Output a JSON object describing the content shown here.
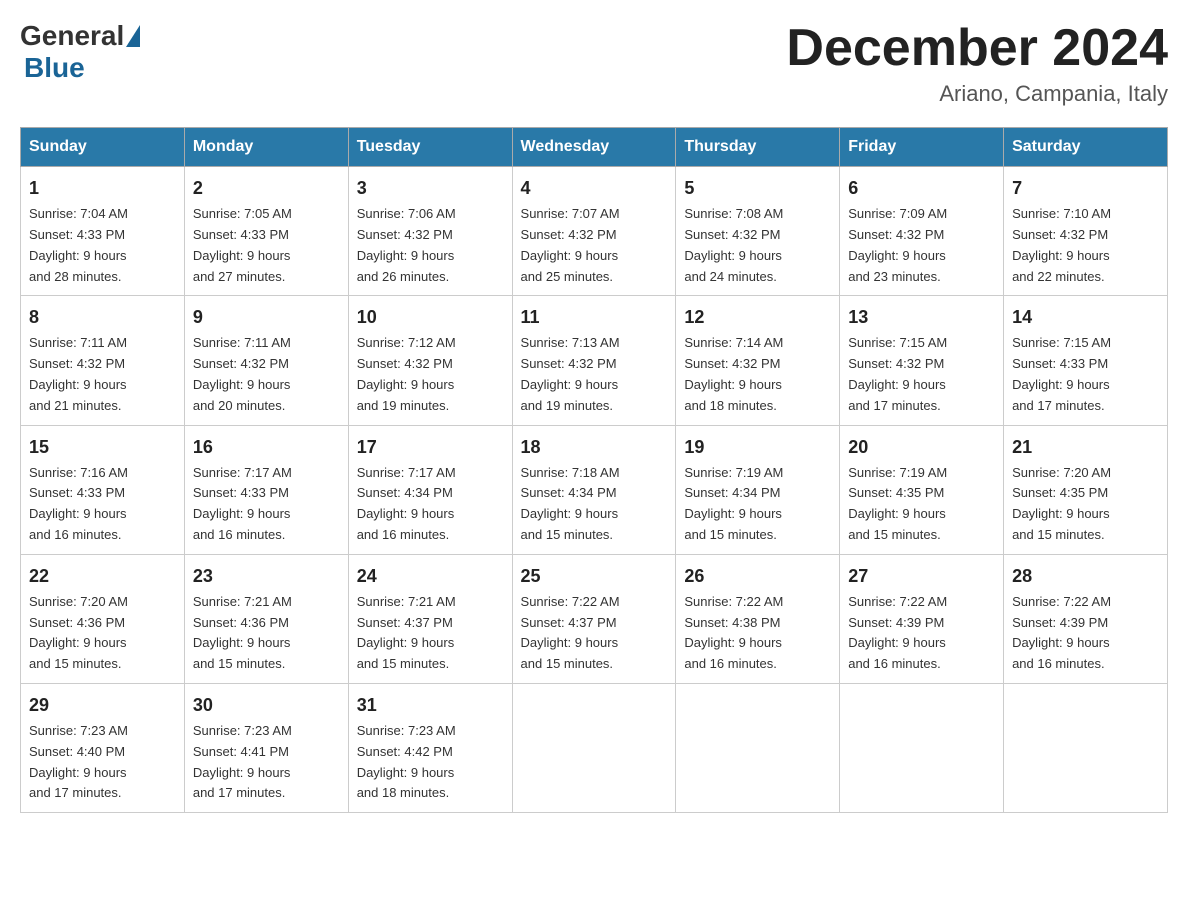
{
  "header": {
    "logo_general": "General",
    "logo_blue": "Blue",
    "month_title": "December 2024",
    "location": "Ariano, Campania, Italy"
  },
  "weekdays": [
    "Sunday",
    "Monday",
    "Tuesday",
    "Wednesday",
    "Thursday",
    "Friday",
    "Saturday"
  ],
  "weeks": [
    [
      {
        "day": "1",
        "sunrise": "7:04 AM",
        "sunset": "4:33 PM",
        "daylight": "9 hours and 28 minutes."
      },
      {
        "day": "2",
        "sunrise": "7:05 AM",
        "sunset": "4:33 PM",
        "daylight": "9 hours and 27 minutes."
      },
      {
        "day": "3",
        "sunrise": "7:06 AM",
        "sunset": "4:32 PM",
        "daylight": "9 hours and 26 minutes."
      },
      {
        "day": "4",
        "sunrise": "7:07 AM",
        "sunset": "4:32 PM",
        "daylight": "9 hours and 25 minutes."
      },
      {
        "day": "5",
        "sunrise": "7:08 AM",
        "sunset": "4:32 PM",
        "daylight": "9 hours and 24 minutes."
      },
      {
        "day": "6",
        "sunrise": "7:09 AM",
        "sunset": "4:32 PM",
        "daylight": "9 hours and 23 minutes."
      },
      {
        "day": "7",
        "sunrise": "7:10 AM",
        "sunset": "4:32 PM",
        "daylight": "9 hours and 22 minutes."
      }
    ],
    [
      {
        "day": "8",
        "sunrise": "7:11 AM",
        "sunset": "4:32 PM",
        "daylight": "9 hours and 21 minutes."
      },
      {
        "day": "9",
        "sunrise": "7:11 AM",
        "sunset": "4:32 PM",
        "daylight": "9 hours and 20 minutes."
      },
      {
        "day": "10",
        "sunrise": "7:12 AM",
        "sunset": "4:32 PM",
        "daylight": "9 hours and 19 minutes."
      },
      {
        "day": "11",
        "sunrise": "7:13 AM",
        "sunset": "4:32 PM",
        "daylight": "9 hours and 19 minutes."
      },
      {
        "day": "12",
        "sunrise": "7:14 AM",
        "sunset": "4:32 PM",
        "daylight": "9 hours and 18 minutes."
      },
      {
        "day": "13",
        "sunrise": "7:15 AM",
        "sunset": "4:32 PM",
        "daylight": "9 hours and 17 minutes."
      },
      {
        "day": "14",
        "sunrise": "7:15 AM",
        "sunset": "4:33 PM",
        "daylight": "9 hours and 17 minutes."
      }
    ],
    [
      {
        "day": "15",
        "sunrise": "7:16 AM",
        "sunset": "4:33 PM",
        "daylight": "9 hours and 16 minutes."
      },
      {
        "day": "16",
        "sunrise": "7:17 AM",
        "sunset": "4:33 PM",
        "daylight": "9 hours and 16 minutes."
      },
      {
        "day": "17",
        "sunrise": "7:17 AM",
        "sunset": "4:34 PM",
        "daylight": "9 hours and 16 minutes."
      },
      {
        "day": "18",
        "sunrise": "7:18 AM",
        "sunset": "4:34 PM",
        "daylight": "9 hours and 15 minutes."
      },
      {
        "day": "19",
        "sunrise": "7:19 AM",
        "sunset": "4:34 PM",
        "daylight": "9 hours and 15 minutes."
      },
      {
        "day": "20",
        "sunrise": "7:19 AM",
        "sunset": "4:35 PM",
        "daylight": "9 hours and 15 minutes."
      },
      {
        "day": "21",
        "sunrise": "7:20 AM",
        "sunset": "4:35 PM",
        "daylight": "9 hours and 15 minutes."
      }
    ],
    [
      {
        "day": "22",
        "sunrise": "7:20 AM",
        "sunset": "4:36 PM",
        "daylight": "9 hours and 15 minutes."
      },
      {
        "day": "23",
        "sunrise": "7:21 AM",
        "sunset": "4:36 PM",
        "daylight": "9 hours and 15 minutes."
      },
      {
        "day": "24",
        "sunrise": "7:21 AM",
        "sunset": "4:37 PM",
        "daylight": "9 hours and 15 minutes."
      },
      {
        "day": "25",
        "sunrise": "7:22 AM",
        "sunset": "4:37 PM",
        "daylight": "9 hours and 15 minutes."
      },
      {
        "day": "26",
        "sunrise": "7:22 AM",
        "sunset": "4:38 PM",
        "daylight": "9 hours and 16 minutes."
      },
      {
        "day": "27",
        "sunrise": "7:22 AM",
        "sunset": "4:39 PM",
        "daylight": "9 hours and 16 minutes."
      },
      {
        "day": "28",
        "sunrise": "7:22 AM",
        "sunset": "4:39 PM",
        "daylight": "9 hours and 16 minutes."
      }
    ],
    [
      {
        "day": "29",
        "sunrise": "7:23 AM",
        "sunset": "4:40 PM",
        "daylight": "9 hours and 17 minutes."
      },
      {
        "day": "30",
        "sunrise": "7:23 AM",
        "sunset": "4:41 PM",
        "daylight": "9 hours and 17 minutes."
      },
      {
        "day": "31",
        "sunrise": "7:23 AM",
        "sunset": "4:42 PM",
        "daylight": "9 hours and 18 minutes."
      },
      null,
      null,
      null,
      null
    ]
  ],
  "labels": {
    "sunrise": "Sunrise:",
    "sunset": "Sunset:",
    "daylight": "Daylight:"
  }
}
